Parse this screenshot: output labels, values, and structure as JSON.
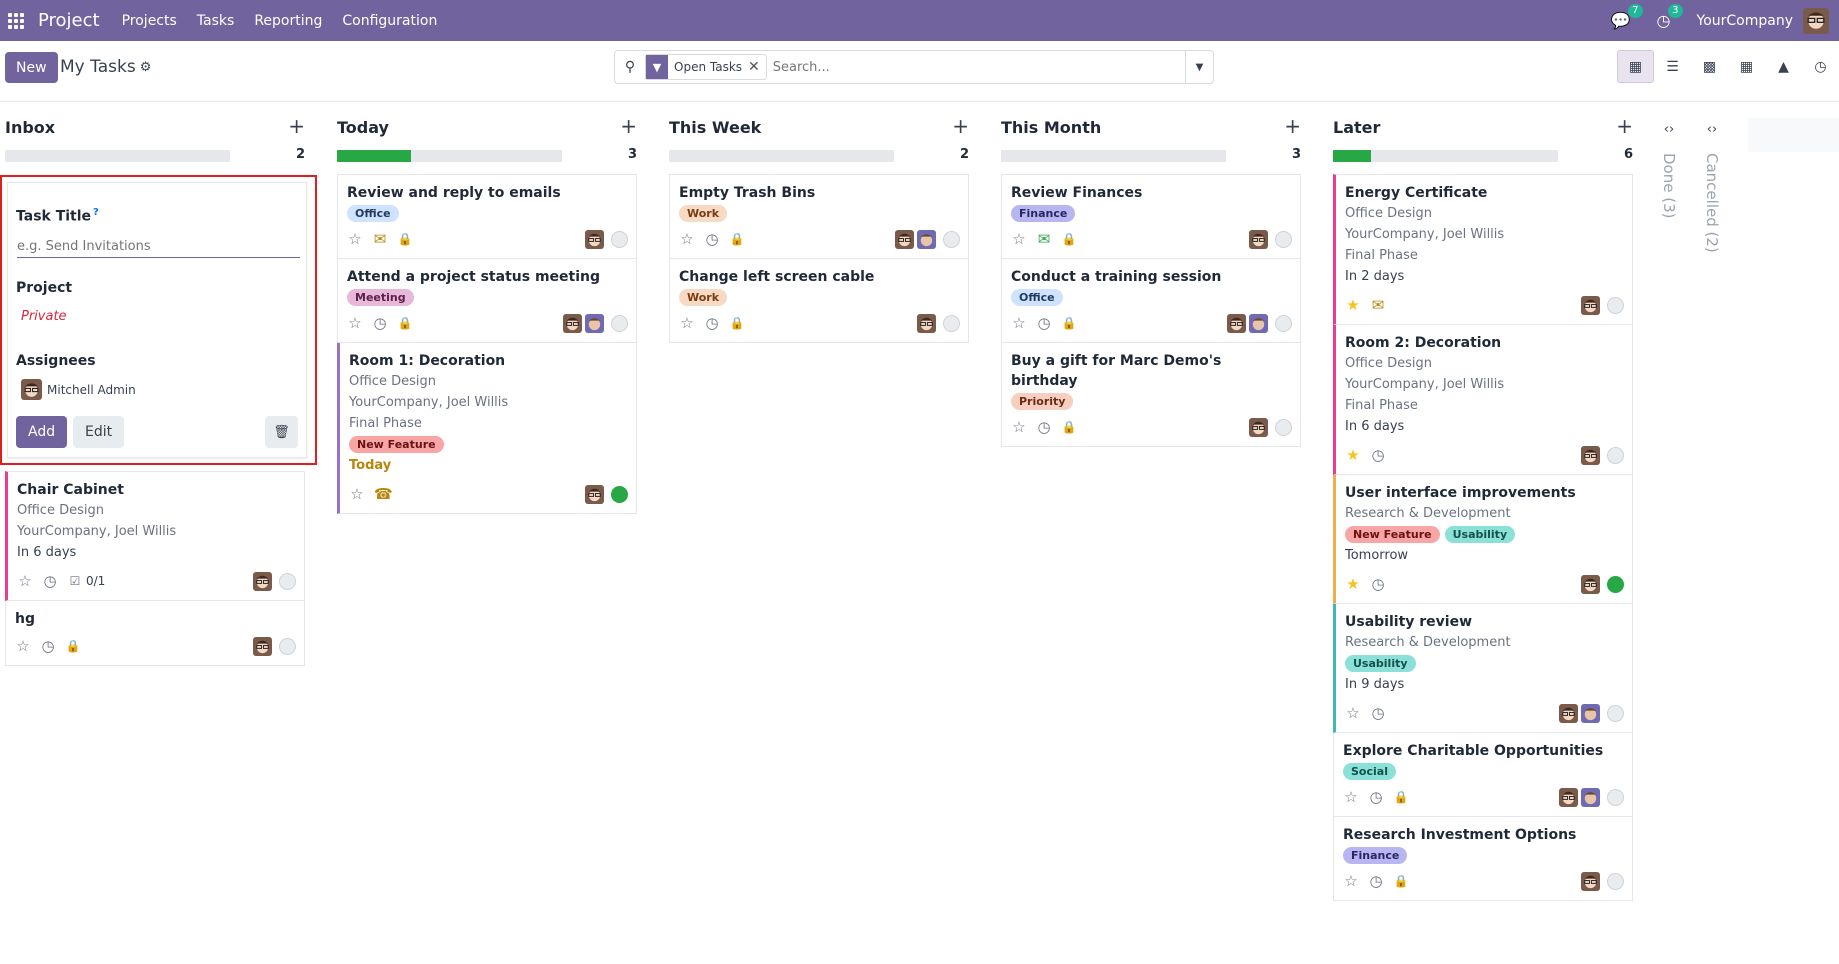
{
  "navbar": {
    "app_name": "Project",
    "menu": [
      "Projects",
      "Tasks",
      "Reporting",
      "Configuration"
    ],
    "messages_count": "7",
    "activities_count": "3",
    "company": "YourCompany",
    "accent_color": "#71639e"
  },
  "control": {
    "new_label": "New",
    "breadcrumb": "My Tasks",
    "facet_label": "Open Tasks",
    "search_placeholder": "Search...",
    "views": [
      "kanban",
      "list",
      "calendar",
      "pivot",
      "graph",
      "activity"
    ]
  },
  "columns": [
    {
      "title": "Inbox",
      "count": "2",
      "progress": 0
    },
    {
      "title": "Today",
      "count": "3",
      "progress": 0.33
    },
    {
      "title": "This Week",
      "count": "2",
      "progress": 0
    },
    {
      "title": "This Month",
      "count": "3",
      "progress": 0
    },
    {
      "title": "Later",
      "count": "6",
      "progress": 0.17
    }
  ],
  "quick_create": {
    "title_label": "Task Title",
    "help_mark": "?",
    "title_placeholder": "e.g. Send Invitations",
    "project_label": "Project",
    "project_value": "Private",
    "assignees_label": "Assignees",
    "assignee_name": "Mitchell Admin",
    "add_label": "Add",
    "edit_label": "Edit"
  },
  "inbox": {
    "c1": {
      "title": "Chair Cabinet",
      "project": "Office Design",
      "partner": "YourCompany, Joel Willis",
      "deadline": "In 6 days",
      "subtasks": "0/1"
    },
    "c2": {
      "title": "hg"
    }
  },
  "today": {
    "c1": {
      "title": "Review and reply to emails",
      "tag": "Office"
    },
    "c2": {
      "title": "Attend a project status meeting",
      "tag": "Meeting"
    },
    "c3": {
      "title": "Room 1: Decoration",
      "project": "Office Design",
      "partner": "YourCompany, Joel Willis",
      "stage": "Final Phase",
      "tag": "New Feature",
      "deadline": "Today"
    }
  },
  "week": {
    "c1": {
      "title": "Empty Trash Bins",
      "tag": "Work"
    },
    "c2": {
      "title": "Change left screen cable",
      "tag": "Work"
    }
  },
  "month": {
    "c1": {
      "title": "Review Finances",
      "tag": "Finance"
    },
    "c2": {
      "title": "Conduct a training session",
      "tag": "Office"
    },
    "c3": {
      "title": "Buy a gift for Marc Demo's birthday",
      "tag": "Priority"
    }
  },
  "later": {
    "c1": {
      "title": "Energy Certificate",
      "project": "Office Design",
      "partner": "YourCompany, Joel Willis",
      "stage": "Final Phase",
      "deadline": "In 2 days"
    },
    "c2": {
      "title": "Room 2: Decoration",
      "project": "Office Design",
      "partner": "YourCompany, Joel Willis",
      "stage": "Final Phase",
      "deadline": "In 6 days"
    },
    "c3": {
      "title": "User interface improvements",
      "project": "Research & Development",
      "tag1": "New Feature",
      "tag2": "Usability",
      "deadline": "Tomorrow"
    },
    "c4": {
      "title": "Usability review",
      "project": "Research & Development",
      "tag": "Usability",
      "deadline": "In 9 days"
    },
    "c5": {
      "title": "Explore Charitable Opportunities",
      "tag": "Social"
    },
    "c6": {
      "title": "Research Investment Options",
      "tag": "Finance"
    }
  },
  "folded": {
    "done": "Done (3)",
    "cancelled": "Cancelled (2)"
  }
}
